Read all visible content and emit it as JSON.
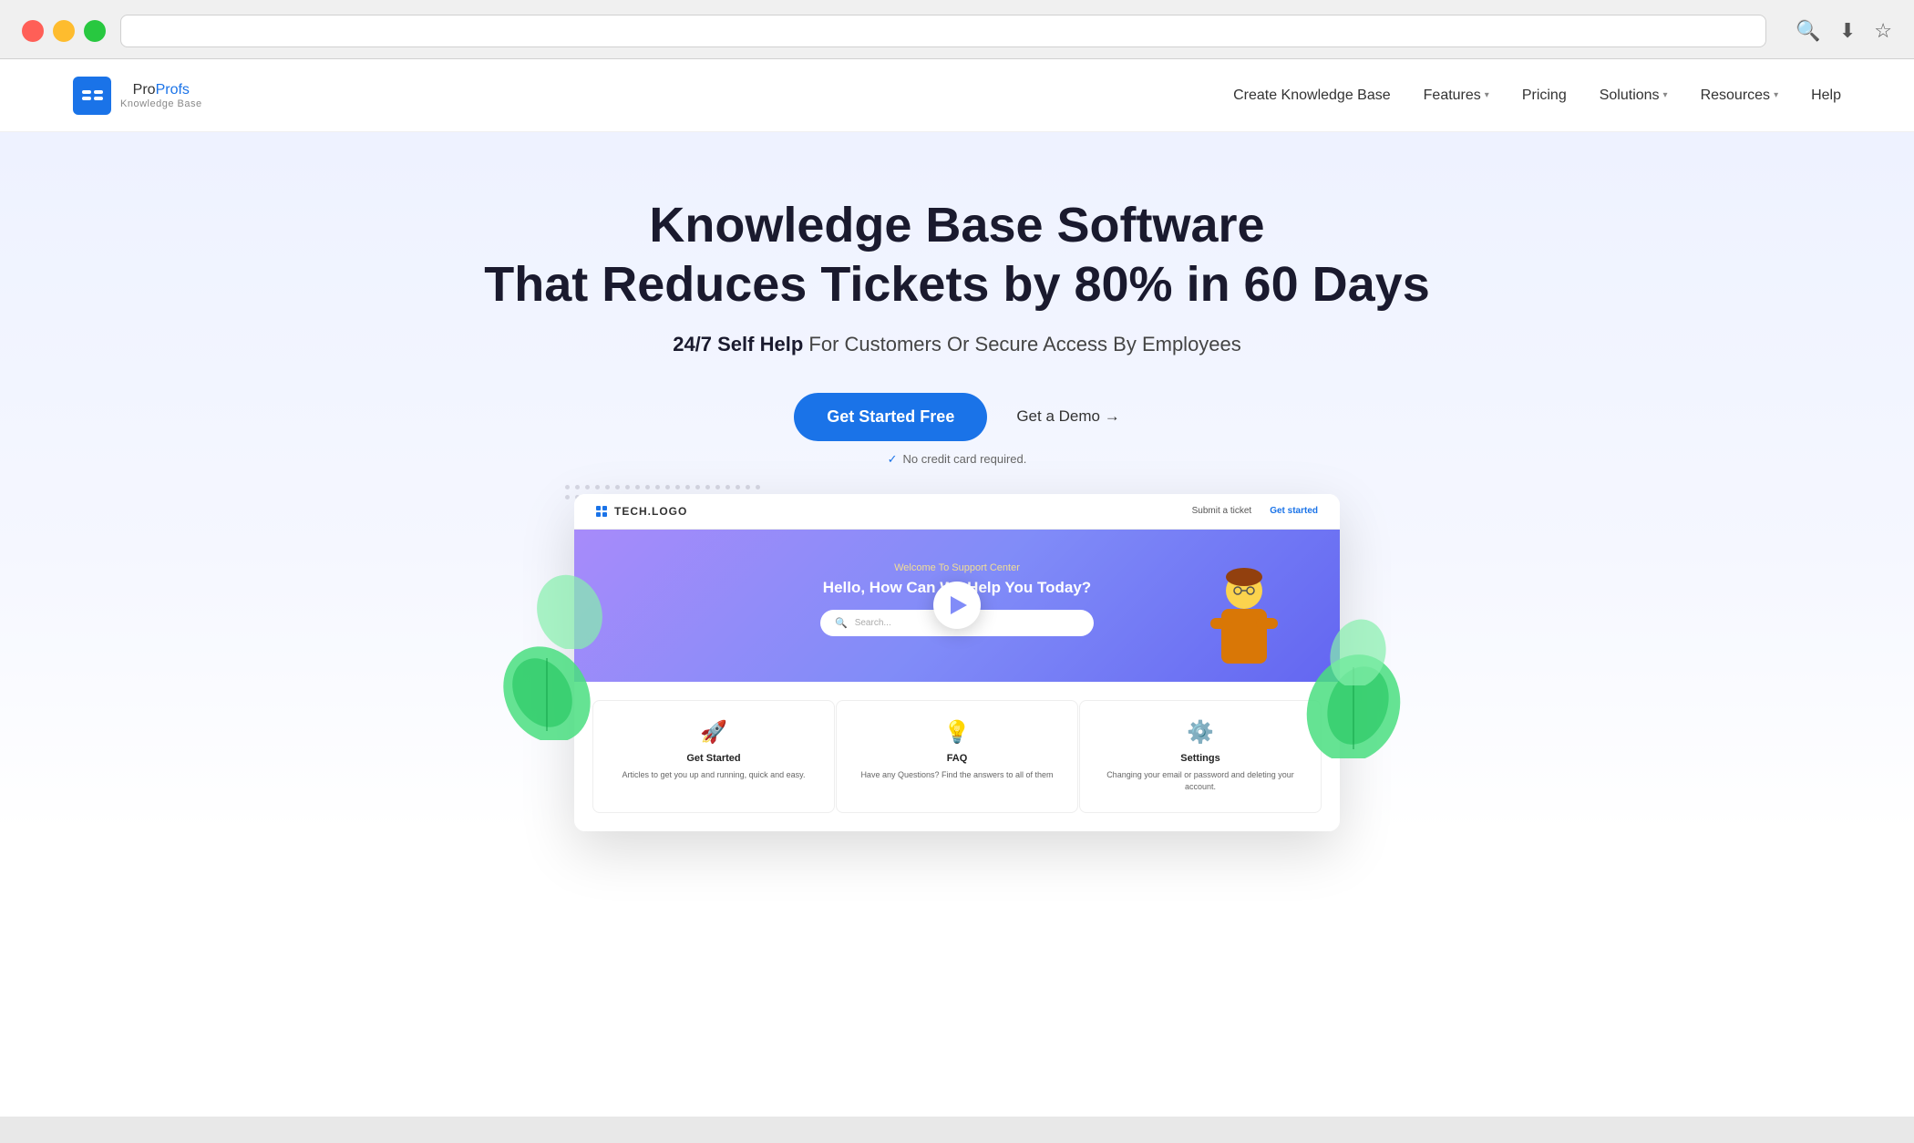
{
  "browser": {
    "address_bar_placeholder": "",
    "search_icon": "🔍",
    "download_icon": "⬇",
    "star_icon": "☆"
  },
  "navbar": {
    "logo_text_pro": "Pro",
    "logo_text_profs": "Profs",
    "logo_subtitle": "Knowledge Base",
    "nav_items": [
      {
        "label": "Create Knowledge Base",
        "has_dropdown": false
      },
      {
        "label": "Features",
        "has_dropdown": true
      },
      {
        "label": "Pricing",
        "has_dropdown": false
      },
      {
        "label": "Solutions",
        "has_dropdown": true
      },
      {
        "label": "Resources",
        "has_dropdown": true
      },
      {
        "label": "Help",
        "has_dropdown": false
      }
    ]
  },
  "hero": {
    "title_line1": "Knowledge Base Software",
    "title_line2": "That Reduces Tickets by 80% in 60 Days",
    "subtitle_bold": "24/7 Self Help",
    "subtitle_rest": " For Customers Or Secure Access By Employees",
    "cta_primary": "Get Started Free",
    "cta_demo": "Get a Demo →",
    "no_cc": "No credit card required."
  },
  "mockup": {
    "logo_text": "TECH.LOGO",
    "nav_link1": "Submit a ticket",
    "nav_link2": "Get started",
    "hero_title": "Welcome To Support Center",
    "hero_main": "Hello, How Can We Help You Today?",
    "search_placeholder": "Search...",
    "cards": [
      {
        "icon": "🚀",
        "title": "Get Started",
        "text": "Articles to get you up and running, quick and easy."
      },
      {
        "icon": "💡",
        "title": "FAQ",
        "text": "Have any Questions? Find the answers to all of them"
      },
      {
        "icon": "⚙️",
        "title": "Settings",
        "text": "Changing your email or password and deleting your account."
      }
    ]
  },
  "colors": {
    "primary_blue": "#1a73e8",
    "hero_gradient_start": "#eef2ff",
    "mockup_purple": "#818cf8",
    "logo_blue": "#1565c0"
  }
}
